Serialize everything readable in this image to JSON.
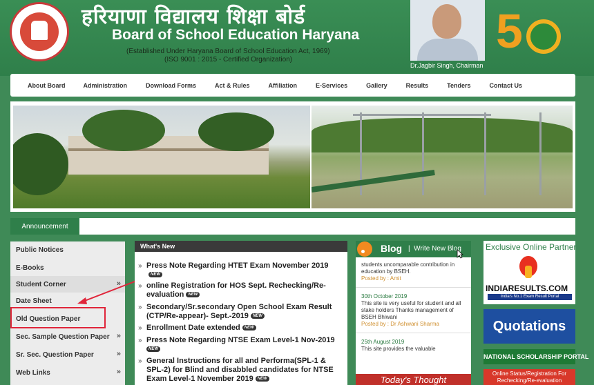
{
  "header": {
    "title_hindi": "हरियाणा विद्यालय शिक्षा बोर्ड",
    "title_english": "Board of School Education Haryana",
    "established": "(Established Under Haryana Board of School Education Act, 1969)",
    "certification": "(ISO 9001 : 2015 - Certified Organization)",
    "chairman_caption": "Dr.Jagbir Singh, Chairman"
  },
  "nav": {
    "items": [
      "About Board",
      "Administration",
      "Download Forms",
      "Act & Rules",
      "Affiliation",
      "E-Services",
      "Gallery",
      "Results",
      "Tenders",
      "Contact Us"
    ]
  },
  "announcement": {
    "tab_label": "Announcement"
  },
  "left_menu": {
    "items": [
      {
        "label": "Public Notices",
        "chevron": ""
      },
      {
        "label": "E-Books",
        "chevron": ""
      },
      {
        "label": "Student Corner",
        "chevron": "»"
      },
      {
        "label": "Date Sheet",
        "chevron": ""
      },
      {
        "label": "Old Question Paper",
        "chevron": ""
      },
      {
        "label": "Sec. Sample Question Paper",
        "chevron": "»"
      },
      {
        "label": "Sr. Sec. Question Paper",
        "chevron": "»"
      },
      {
        "label": "Web Links",
        "chevron": "»"
      }
    ]
  },
  "whats_new": {
    "heading": "What's New",
    "new_badge": "NEW",
    "items": [
      "Press Note Regarding HTET Exam November 2019",
      "online Registration for HOS Sept. Rechecking/Re-evaluation",
      "Secondary/Sr.secondary Open School Exam Result (CTP/Re-appear)- Sept.-2019",
      "Enrollment Date extended",
      "Press Note Regarding NTSE Exam Level-1 Nov-2019",
      "General Instructions for all and Performa(SPL-1 & SPL-2) for Blind and disabbled candidates for NTSE Exam Level-1 November 2019"
    ]
  },
  "blog": {
    "title": "Blog",
    "separator": "|",
    "write_link": "Write New Blog",
    "entries": [
      {
        "date": "",
        "text": "students.uncomparable contribution in education by BSEH.",
        "by": "Posted by : Amit"
      },
      {
        "date": "30th October 2019",
        "text": "This site is very useful for student and all stake holders Thanks management of BSEH Bhiwani",
        "by": "Posted by : Dr Ashwani Sharma"
      },
      {
        "date": "25th August 2019",
        "text": "This site provides the valuable",
        "by": ""
      }
    ],
    "thought_banner": "Today's Thought"
  },
  "right_column": {
    "partner_title": "Exclusive Online Partner",
    "partner_name": "INDIARESULTS.COM",
    "partner_tagline": "India's No.1 Exam Result Portal",
    "quotations": "Quotations",
    "scholarship": "NATIONAL SCHOLARSHIP PORTAL",
    "online_status": "Online Status/Registration For Rechecking/Re-evaluation"
  },
  "colors": {
    "brand_green": "#2f7f4a",
    "highlight_red": "#e0253a"
  }
}
